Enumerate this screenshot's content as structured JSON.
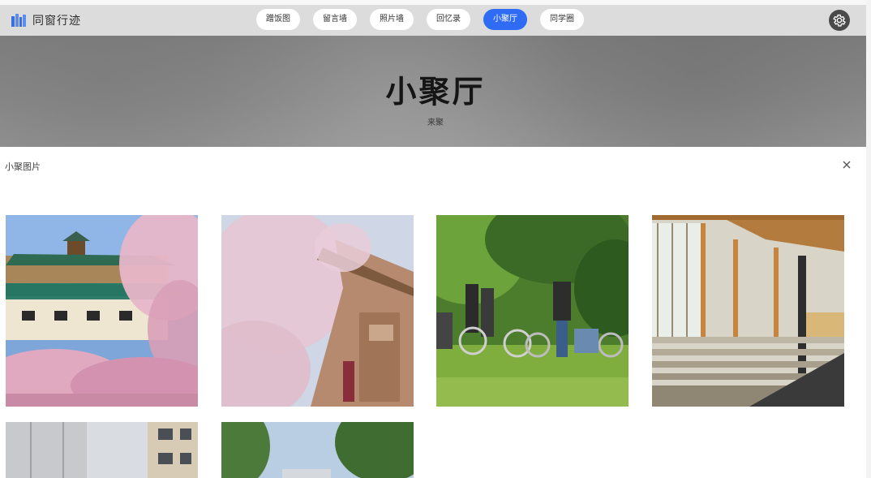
{
  "app": {
    "brand": "同窗行迹"
  },
  "nav": {
    "tabs": [
      {
        "label": "蹭饭图"
      },
      {
        "label": "留言墙"
      },
      {
        "label": "照片墙"
      },
      {
        "label": "回忆录"
      },
      {
        "label": "小聚厅",
        "active": true
      },
      {
        "label": "同学圈"
      }
    ],
    "accent_color": "#2f6bf3",
    "settings_icon": "gear-icon"
  },
  "hero": {
    "title": "小聚厅",
    "subtitle": "来聚"
  },
  "panel": {
    "title": "小聚图片",
    "close_icon": "close-icon",
    "photos": [
      {
        "subject": "cherry-blossoms-and-traditional-building"
      },
      {
        "subject": "cherry-blossoms-and-pagoda-roof"
      },
      {
        "subject": "students-with-bicycles-on-lawn"
      },
      {
        "subject": "library-atrium-with-stairs"
      },
      {
        "subject": "modern-building-facade"
      },
      {
        "subject": "trees-and-sky"
      }
    ]
  }
}
